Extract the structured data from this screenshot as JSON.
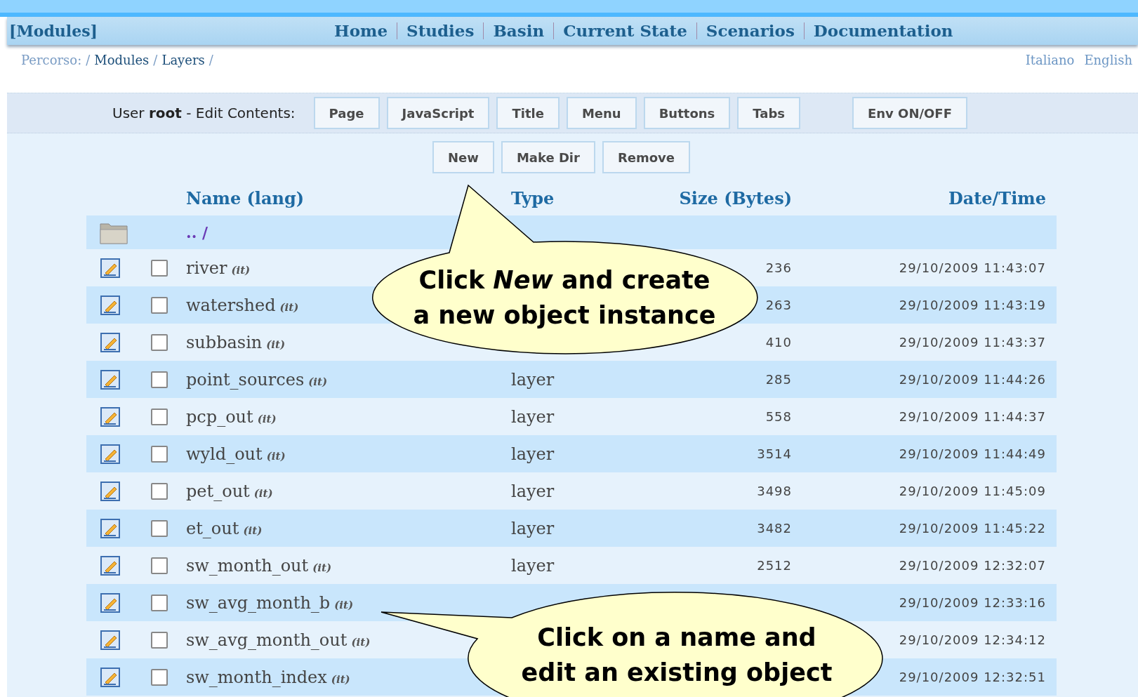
{
  "navbar": {
    "brand": "[Modules]",
    "items": [
      {
        "label": "Home"
      },
      {
        "label": "Studies"
      },
      {
        "label": "Basin"
      },
      {
        "label": "Current State"
      },
      {
        "label": "Scenarios"
      },
      {
        "label": "Documentation"
      }
    ]
  },
  "breadcrumb": {
    "label": "Percorso:",
    "items": [
      {
        "kind": "separator",
        "text": "/"
      },
      {
        "kind": "link",
        "text": "Modules"
      },
      {
        "kind": "separator",
        "text": "/"
      },
      {
        "kind": "link",
        "text": "Layers"
      },
      {
        "kind": "separator",
        "text": "/"
      }
    ]
  },
  "languages": [
    "Italiano",
    "English"
  ],
  "toolbar": {
    "prefix": "User",
    "user": "root",
    "suffix": "- Edit Contents:",
    "buttons": [
      "Page",
      "JavaScript",
      "Title",
      "Menu",
      "Buttons",
      "Tabs"
    ],
    "env_button": "Env ON/OFF"
  },
  "actions": [
    "New",
    "Make Dir",
    "Remove"
  ],
  "table": {
    "columns": [
      "Name (lang)",
      "Type",
      "Size (Bytes)",
      "Date/Time"
    ],
    "parent": ".. /",
    "rows": [
      {
        "name": "river",
        "lang": "(it)",
        "size": "236",
        "datetime": "29/10/2009 11:43:07",
        "checked": false
      },
      {
        "name": "watershed",
        "lang": "(it)",
        "size": "263",
        "datetime": "29/10/2009 11:43:19",
        "checked": false
      },
      {
        "name": "subbasin",
        "lang": "(it)",
        "size": "410",
        "datetime": "29/10/2009 11:43:37",
        "checked": false
      },
      {
        "name": "point_sources",
        "lang": "(it)",
        "type": "layer",
        "size": "285",
        "datetime": "29/10/2009 11:44:26",
        "checked": false
      },
      {
        "name": "pcp_out",
        "lang": "(it)",
        "type": "layer",
        "size": "558",
        "datetime": "29/10/2009 11:44:37",
        "checked": false
      },
      {
        "name": "wyld_out",
        "lang": "(it)",
        "type": "layer",
        "size": "3514",
        "datetime": "29/10/2009 11:44:49",
        "checked": false
      },
      {
        "name": "pet_out",
        "lang": "(it)",
        "type": "layer",
        "size": "3498",
        "datetime": "29/10/2009 11:45:09",
        "checked": false
      },
      {
        "name": "et_out",
        "lang": "(it)",
        "type": "layer",
        "size": "3482",
        "datetime": "29/10/2009 11:45:22",
        "checked": false
      },
      {
        "name": "sw_month_out",
        "lang": "(it)",
        "type": "layer",
        "size": "2512",
        "datetime": "29/10/2009 12:32:07",
        "checked": false
      },
      {
        "name": "sw_avg_month_b",
        "lang": "(it)",
        "datetime": "29/10/2009 12:33:16",
        "checked": false
      },
      {
        "name": "sw_avg_month_out",
        "lang": "(it)",
        "datetime": "29/10/2009 12:34:12",
        "checked": false
      },
      {
        "name": "sw_month_index",
        "lang": "(it)",
        "datetime": "29/10/2009 12:32:51",
        "checked": false
      }
    ]
  },
  "callouts": [
    {
      "lines": [
        "Click *New* and create",
        "a new object instance"
      ]
    },
    {
      "lines": [
        "Click on a name and",
        "edit an existing object"
      ]
    }
  ]
}
